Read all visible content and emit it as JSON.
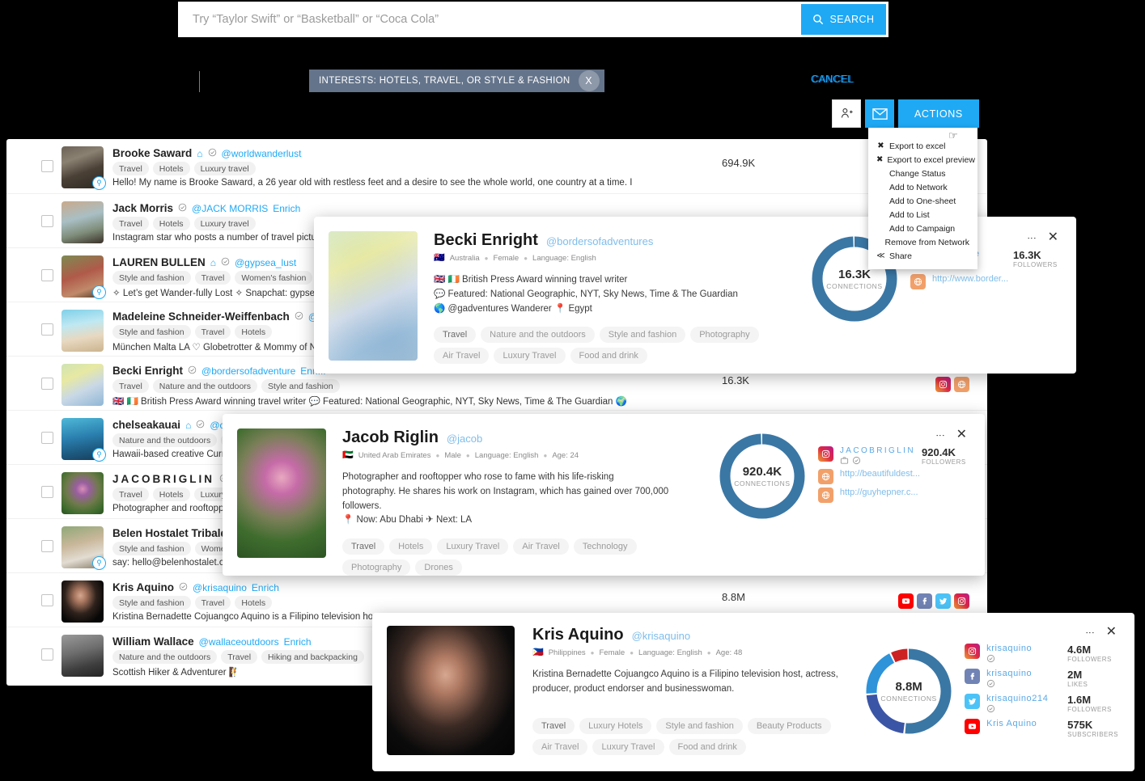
{
  "search": {
    "placeholder": "Try “Taylor Swift” or “Basketball” or “Coca Cola”",
    "value": "",
    "button_label": "SEARCH"
  },
  "filter": {
    "chip_label": "INTERESTS: HOTELS, TRAVEL, OR STYLE & FASHION",
    "chip_close": "X",
    "cancel_label": "CANCEL"
  },
  "toolbar": {
    "add_user_icon": "add-user-icon",
    "email_icon": "envelope-icon",
    "actions_label": "ACTIONS"
  },
  "dropdown": {
    "items": [
      {
        "label": "Export to excel",
        "glyph": "✖"
      },
      {
        "label": "Export to excel preview",
        "glyph": "✖"
      },
      {
        "label": "Change Status",
        "glyph": ""
      },
      {
        "label": "Add to Network",
        "glyph": ""
      },
      {
        "label": "Add to One-sheet",
        "glyph": ""
      },
      {
        "label": "Add to List",
        "glyph": ""
      },
      {
        "label": "Add to Campaign",
        "glyph": ""
      },
      {
        "label": "Remove from Network",
        "glyph": ""
      },
      {
        "label": "Share",
        "glyph": "≪"
      }
    ]
  },
  "list": {
    "rows": [
      {
        "name": "Brooke Saward",
        "name_spaced": false,
        "home": true,
        "verified": true,
        "handle": "@worldwanderlust",
        "enrich": "",
        "tags": [
          "Travel",
          "Hotels",
          "Luxury travel"
        ],
        "bio": "Hello! My name is Brooke Saward, a 26 year old with restless feet and a desire to see the whole world, one country at a time. I",
        "count": "694.9K",
        "socials": [],
        "magnifier": true,
        "avatar": "brooke"
      },
      {
        "name": "Jack Morris",
        "name_spaced": false,
        "home": false,
        "verified": true,
        "handle": "@JACK MORRIS",
        "enrich": "Enrich",
        "tags": [
          "Travel",
          "Hotels",
          "Luxury travel"
        ],
        "bio": "Instagram star who posts a number of travel pictu",
        "count": "",
        "socials": [],
        "magnifier": false,
        "avatar": "jack"
      },
      {
        "name": "LAUREN BULLEN",
        "name_spaced": false,
        "home": true,
        "verified": true,
        "handle": "@gypsea_lust",
        "enrich": "",
        "tags": [
          "Style and fashion",
          "Travel",
          "Women's fashion"
        ],
        "bio": "✧ Let’s get Wander-fully Lost ✧ Snapchat: gypsea",
        "count": "",
        "socials": [],
        "magnifier": true,
        "avatar": "lauren"
      },
      {
        "name": "Madeleine Schneider-Weiffenbach",
        "name_spaced": false,
        "home": false,
        "verified": true,
        "handle": "@M",
        "enrich": "",
        "tags": [
          "Style and fashion",
          "Travel",
          "Hotels"
        ],
        "bio": "München Malta LA ♡ Globetrotter & Mommy of N",
        "count": "",
        "socials": [],
        "magnifier": false,
        "avatar": "madeleine"
      },
      {
        "name": "Becki Enright",
        "name_spaced": false,
        "home": false,
        "verified": true,
        "handle": "@bordersofadventure",
        "enrich": "Enri...",
        "tags": [
          "Travel",
          "Nature and the outdoors",
          "Style and fashion"
        ],
        "bio": "🇬🇧 🇮🇪 British Press Award winning travel writer 💬 Featured: National Geographic, NYT, Sky News, Time & The Guardian 🌍",
        "count": "16.3K",
        "socials": [
          "ig",
          "web"
        ],
        "magnifier": false,
        "avatar": "becki"
      },
      {
        "name": "chelseakauai",
        "name_spaced": false,
        "home": true,
        "verified": true,
        "handle": "@c",
        "enrich": "",
        "tags": [
          "Nature and the outdoors",
          "T"
        ],
        "bio": "Hawaii-based creative Curre",
        "count": "",
        "socials": [],
        "magnifier": true,
        "avatar": "chelsea"
      },
      {
        "name": "JACOBRIGLIN",
        "name_spaced": true,
        "home": false,
        "verified": true,
        "handle": "",
        "enrich": "",
        "tags": [
          "Travel",
          "Hotels",
          "Luxury tr"
        ],
        "bio": "Photographer and rooftoppe",
        "count": "",
        "socials": [],
        "magnifier": false,
        "avatar": "jacob"
      },
      {
        "name": "Belen Hostalet Tribaldos",
        "name_spaced": false,
        "home": false,
        "verified": false,
        "handle": "",
        "enrich": "",
        "tags": [
          "Style and fashion",
          "Women's"
        ],
        "bio": "say: hello@belenhostalet.com",
        "count": "",
        "socials": [],
        "magnifier": true,
        "avatar": "belen"
      },
      {
        "name": "Kris Aquino",
        "name_spaced": false,
        "home": false,
        "verified": true,
        "handle": "@krisaquino",
        "enrich": "Enrich",
        "tags": [
          "Style and fashion",
          "Travel",
          "Hotels"
        ],
        "bio": "Kristina Bernadette Cojuangco Aquino is a Filipino television host",
        "count": "8.8M",
        "socials": [
          "yt",
          "fb",
          "tw",
          "ig"
        ],
        "magnifier": false,
        "avatar": "kris"
      },
      {
        "name": "William Wallace",
        "name_spaced": false,
        "home": false,
        "verified": false,
        "handle": "@wallaceoutdoors",
        "enrich": "Enrich",
        "tags": [
          "Nature and the outdoors",
          "Travel",
          "Hiking and backpacking"
        ],
        "bio": "Scottish Hiker & Adventurer 🧗",
        "count": "",
        "socials": [],
        "magnifier": false,
        "avatar": "william"
      }
    ]
  },
  "card_becki": {
    "name": "Becki Enright",
    "handle": "@bordersofadventures",
    "flag": "🇦🇺",
    "country": "Australia",
    "gender": "Female",
    "language": "Language: English",
    "bio_lines": [
      "🇬🇧 🇮🇪 British Press Award winning travel writer",
      "💬 Featured: National Geographic, NYT, Sky News, Time & The Guardian",
      "🌎 @gadventures Wanderer 📍 Egypt"
    ],
    "tags": [
      "Travel",
      "Nature and the outdoors",
      "Style and fashion",
      "Photography",
      "Air Travel",
      "Luxury Travel",
      "Food and drink"
    ],
    "donut_value": "16.3K",
    "donut_label": "CONNECTIONS",
    "stats": [
      {
        "platform": "instagram",
        "user": "...dventure",
        "value": "16.3K",
        "label": "FOLLOWERS",
        "spaced": false,
        "verified": true
      }
    ],
    "link": "http://www.border..."
  },
  "card_jacob": {
    "name": "Jacob Riglin",
    "handle": "@jacob",
    "flag": "🇦🇪",
    "country": "United Arab Emirates",
    "gender": "Male",
    "language": "Language: English",
    "age": "Age: 24",
    "bio_lines": [
      "Photographer and rooftopper who rose to fame with his life-risking",
      "photography. He shares his work on Instagram, which has gained over 700,000",
      "followers.",
      "📍 Now: Abu Dhabi ✈ Next: LA"
    ],
    "tags": [
      "Travel",
      "Hotels",
      "Luxury Travel",
      "Air Travel",
      "Technology",
      "Photography",
      "Drones"
    ],
    "donut_value": "920.4K",
    "donut_label": "CONNECTIONS",
    "stats": [
      {
        "platform": "instagram",
        "user": "JACOBRIGLIN",
        "value": "920.4K",
        "label": "FOLLOWERS",
        "spaced": true,
        "verified": true
      }
    ],
    "links": [
      "http://beautifuldest...",
      "http://guyhepner.c..."
    ]
  },
  "card_kris": {
    "name": "Kris Aquino",
    "handle": "@krisaquino",
    "flag": "🇵🇭",
    "country": "Philippines",
    "gender": "Female",
    "language": "Language: English",
    "age": "Age: 48",
    "bio_lines": [
      "Kristina Bernadette Cojuangco Aquino is a Filipino television host, actress,",
      "producer, product endorser and businesswoman."
    ],
    "tags": [
      "Travel",
      "Luxury Hotels",
      "Style and fashion",
      "Beauty Products",
      "Air Travel",
      "Luxury Travel",
      "Food and drink"
    ],
    "donut_value": "8.8M",
    "donut_label": "CONNECTIONS",
    "stats": [
      {
        "platform": "instagram",
        "user": "krisaquino",
        "value": "4.6M",
        "label": "FOLLOWERS",
        "spaced": false,
        "verified": true
      },
      {
        "platform": "facebook",
        "user": "krisaquino",
        "value": "2M",
        "label": "LIKES",
        "spaced": false,
        "verified": true
      },
      {
        "platform": "twitter",
        "user": "krisaquino214",
        "value": "1.6M",
        "label": "FOLLOWERS",
        "spaced": false,
        "verified": true
      },
      {
        "platform": "youtube",
        "user": "Kris Aquino",
        "value": "575K",
        "label": "SUBSCRIBERS",
        "spaced": false,
        "verified": false
      }
    ]
  },
  "chart_data": [
    {
      "type": "pie",
      "title": "Becki Enright connections",
      "center_label": "16.3K",
      "center_sub": "CONNECTIONS",
      "segments": [
        {
          "name": "Instagram",
          "value": 100,
          "color": "#3a77a5"
        }
      ],
      "total": "16.3K"
    },
    {
      "type": "pie",
      "title": "Jacob Riglin connections",
      "center_label": "920.4K",
      "center_sub": "CONNECTIONS",
      "segments": [
        {
          "name": "Instagram",
          "value": 100,
          "color": "#3a77a5"
        }
      ],
      "total": "920.4K"
    },
    {
      "type": "pie",
      "title": "Kris Aquino connections",
      "center_label": "8.8M",
      "center_sub": "CONNECTIONS",
      "segments": [
        {
          "name": "Instagram",
          "value": 52,
          "color": "#3a77a5"
        },
        {
          "name": "Facebook",
          "value": 22,
          "color": "#3b55a6"
        },
        {
          "name": "Twitter",
          "value": 19,
          "color": "#2e93d9"
        },
        {
          "name": "YouTube",
          "value": 7,
          "color": "#cc2222"
        }
      ],
      "total": "8.8M"
    }
  ],
  "colors": {
    "accent": "#1FA9F5",
    "donut": "#3a77a5",
    "chip": "#64748b",
    "instagram": "#dc2743",
    "facebook": "#7183b4",
    "twitter": "#4cc3f7",
    "youtube": "#ff0000"
  }
}
